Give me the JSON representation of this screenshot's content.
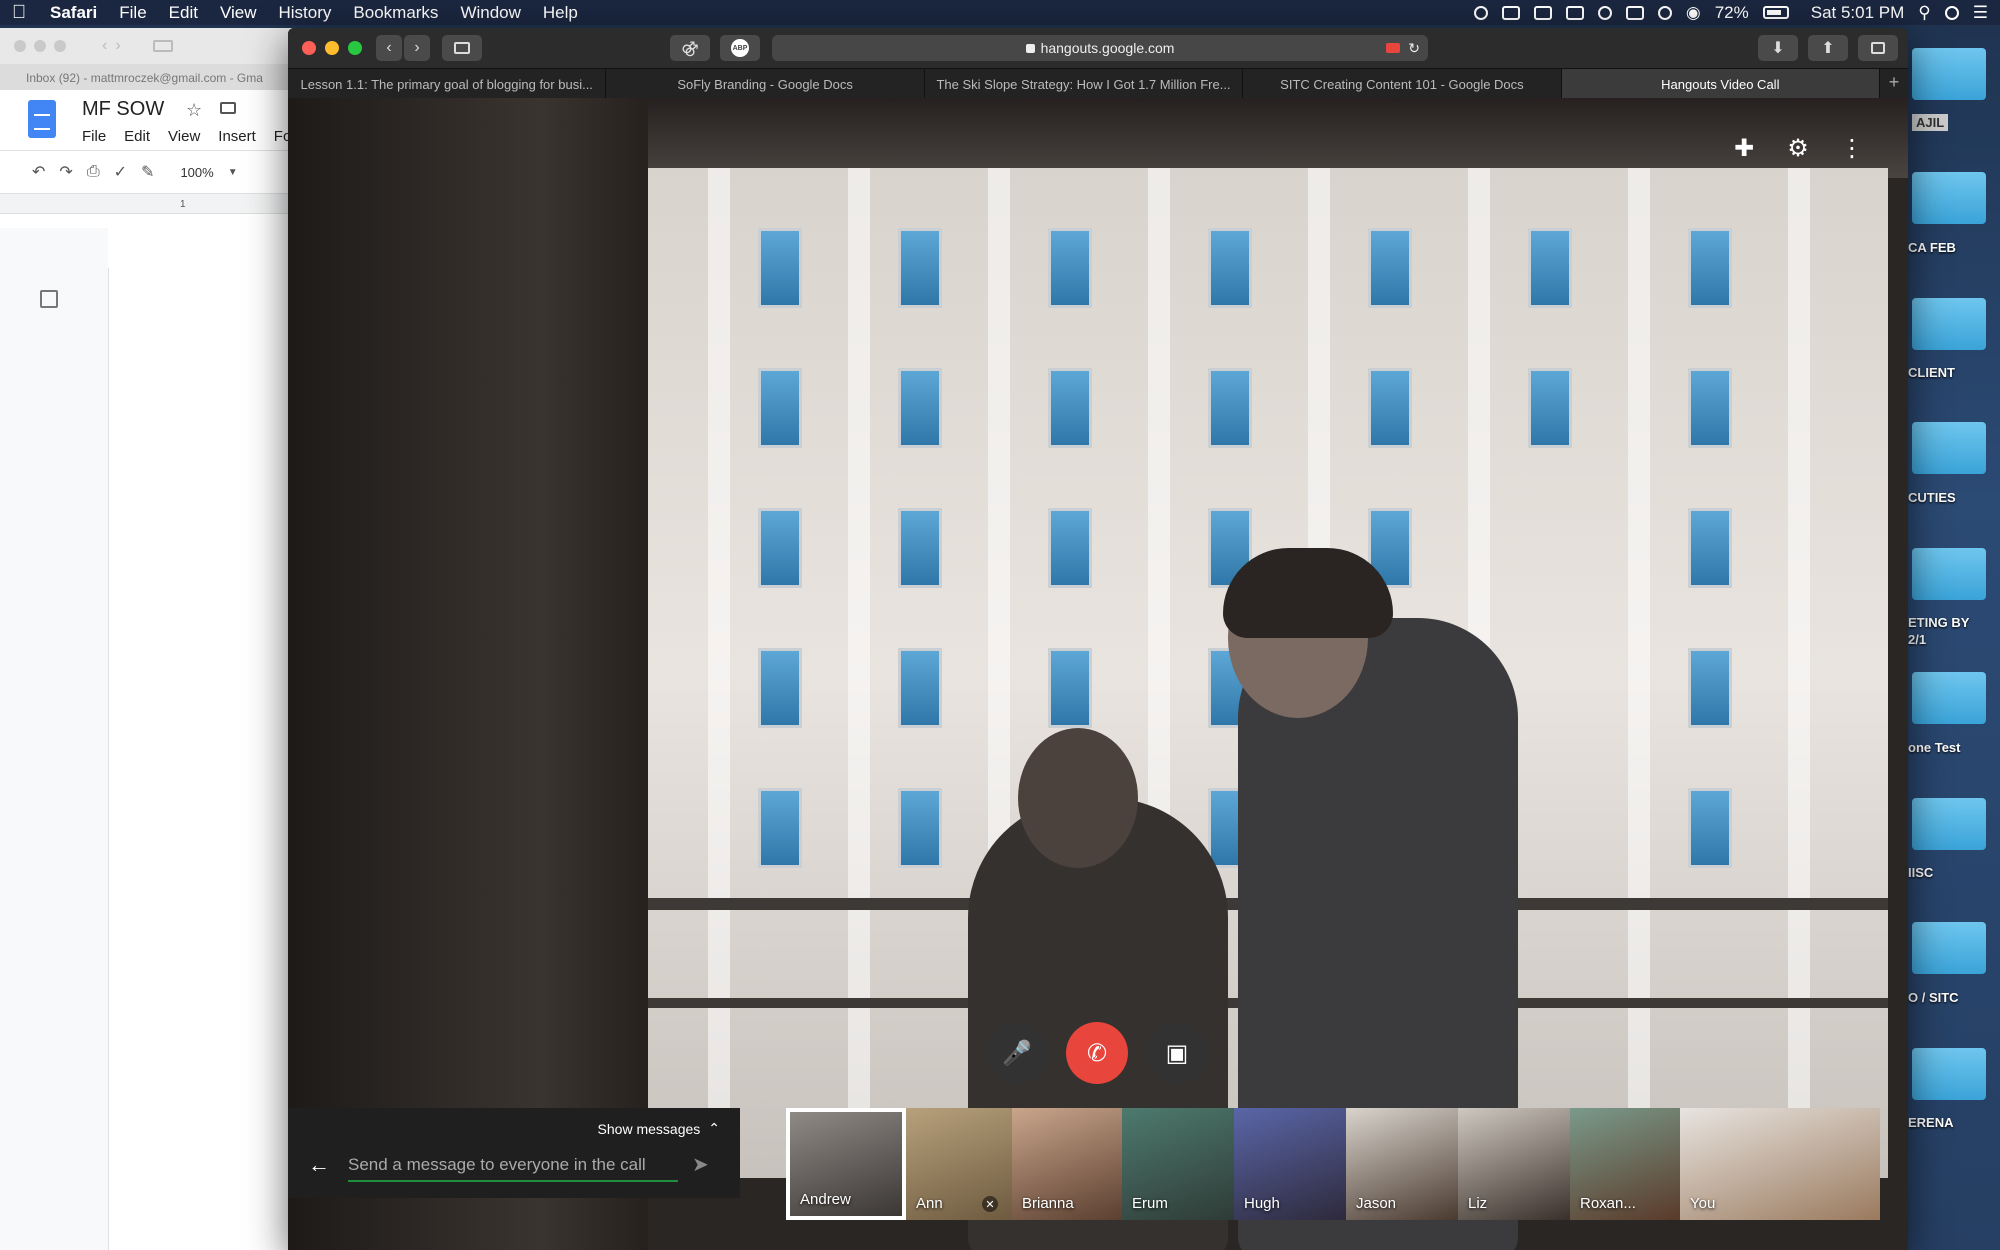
{
  "menubar": {
    "app": "Safari",
    "items": [
      "File",
      "Edit",
      "View",
      "History",
      "Bookmarks",
      "Window",
      "Help"
    ],
    "battery": "72%",
    "clock": "Sat 5:01 PM"
  },
  "desktop": {
    "labels": [
      "AJIL",
      "CA FEB",
      "CLIENT",
      "CUTIES",
      "ETING BY",
      "2/1",
      "one Test",
      "IISC",
      "O / SITC",
      "ERENA"
    ]
  },
  "docs": {
    "tab_title": "Inbox (92) - mattmroczek@gmail.com - Gma",
    "doc_title": "MF SOW",
    "menu": [
      "File",
      "Edit",
      "View",
      "Insert",
      "Fo"
    ],
    "zoom": "100%",
    "ruler_mark": "1"
  },
  "safari": {
    "url": "hangouts.google.com",
    "tabs": [
      "Lesson 1.1: The primary goal of blogging for busi...",
      "SoFly Branding - Google Docs",
      "The Ski Slope Strategy: How I Got 1.7 Million Fre...",
      "SITC Creating Content 101 - Google Docs",
      "Hangouts Video Call"
    ],
    "abp_label": "ABP"
  },
  "call": {
    "chat": {
      "toggle_label": "Show messages",
      "placeholder": "Send a message to everyone in the call"
    },
    "participants": [
      {
        "name": "Andrew",
        "selected": true,
        "muted": false
      },
      {
        "name": "Ann",
        "selected": false,
        "muted": true
      },
      {
        "name": "Brianna",
        "selected": false,
        "muted": false
      },
      {
        "name": "Erum",
        "selected": false,
        "muted": false
      },
      {
        "name": "Hugh",
        "selected": false,
        "muted": false
      },
      {
        "name": "Jason",
        "selected": false,
        "muted": false
      },
      {
        "name": "Liz",
        "selected": false,
        "muted": false
      },
      {
        "name": "Roxan...",
        "selected": false,
        "muted": false
      },
      {
        "name": "You",
        "selected": false,
        "muted": false
      }
    ]
  }
}
